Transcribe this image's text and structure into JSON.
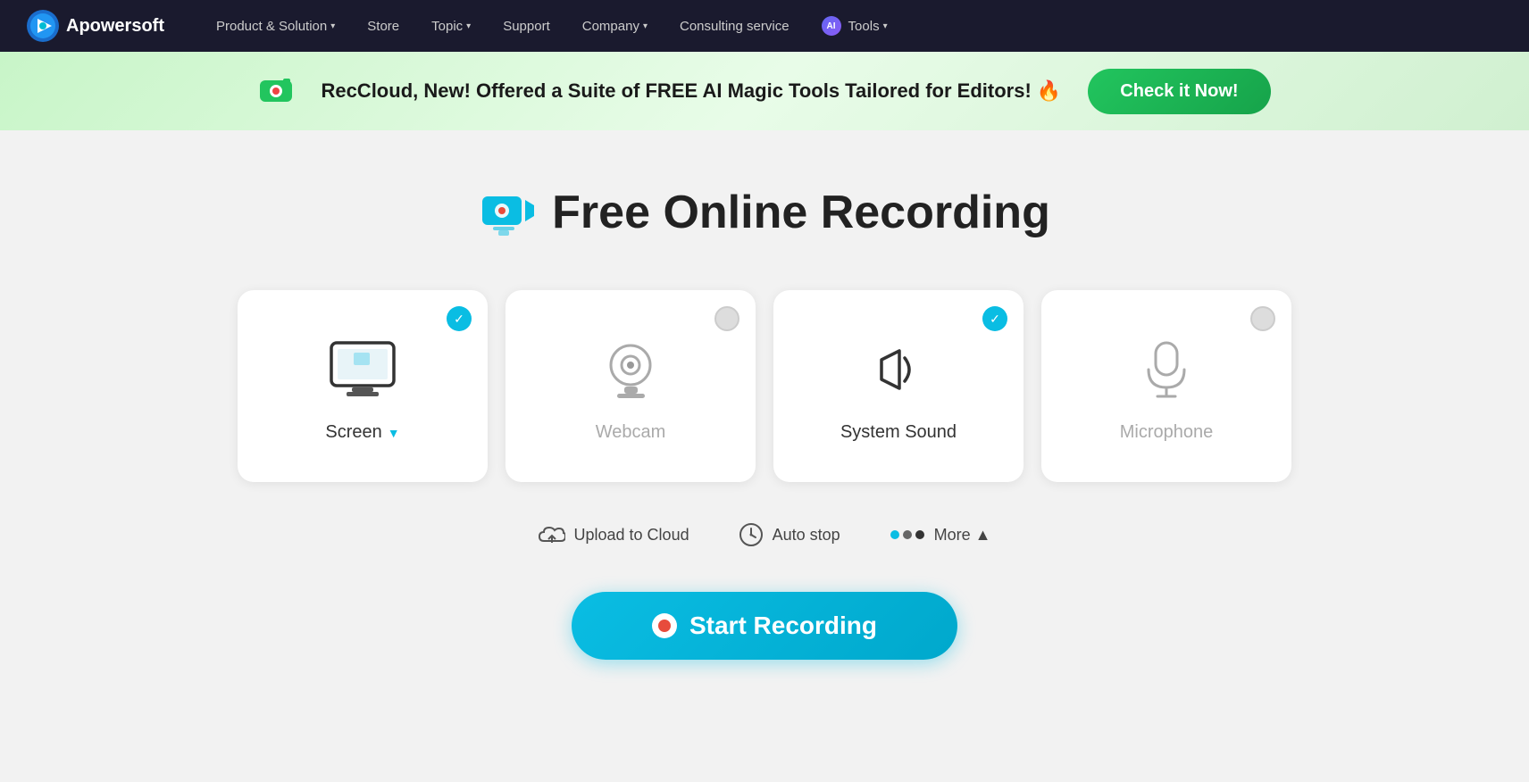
{
  "nav": {
    "logo_text": "Apowersoft",
    "items": [
      {
        "label": "Product & Solution",
        "has_dropdown": true
      },
      {
        "label": "Store",
        "has_dropdown": false
      },
      {
        "label": "Topic",
        "has_dropdown": true
      },
      {
        "label": "Support",
        "has_dropdown": false
      },
      {
        "label": "Company",
        "has_dropdown": true
      },
      {
        "label": "Consulting service",
        "has_dropdown": false
      },
      {
        "label": "Tools",
        "has_dropdown": true,
        "has_ai": true
      }
    ]
  },
  "banner": {
    "text": "RecCloud, New! Offered a Suite of FREE AI Magic Tools Tailored for Editors! 🔥",
    "button_label": "Check it Now!"
  },
  "page": {
    "title": "Free Online Recording",
    "options": [
      {
        "id": "screen",
        "label": "Screen",
        "checked": true,
        "has_dropdown": true,
        "muted": false
      },
      {
        "id": "webcam",
        "label": "Webcam",
        "checked": false,
        "has_dropdown": false,
        "muted": true
      },
      {
        "id": "system_sound",
        "label": "System Sound",
        "checked": true,
        "has_dropdown": false,
        "muted": false
      },
      {
        "id": "microphone",
        "label": "Microphone",
        "checked": false,
        "has_dropdown": false,
        "muted": true
      }
    ],
    "extras": [
      {
        "id": "upload",
        "label": "Upload to Cloud"
      },
      {
        "id": "autostop",
        "label": "Auto stop"
      },
      {
        "id": "more",
        "label": "More ▲"
      }
    ],
    "start_button": "Start Recording"
  }
}
